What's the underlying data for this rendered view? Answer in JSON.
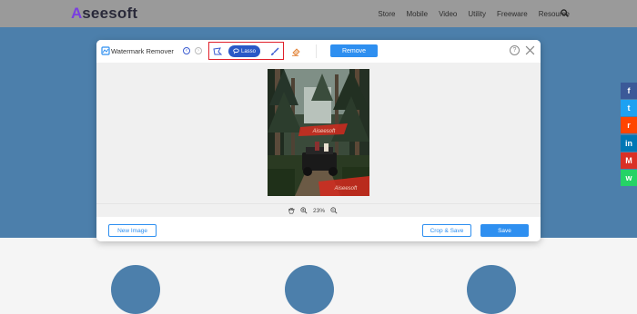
{
  "site": {
    "logo_text": "seesoft",
    "nav": [
      "Store",
      "Mobile",
      "Video",
      "Utility",
      "Freeware",
      "Resource"
    ],
    "search_icon": "search-icon"
  },
  "social": [
    {
      "name": "facebook-icon",
      "glyph": "f",
      "color": "#3b5998"
    },
    {
      "name": "twitter-icon",
      "glyph": "t",
      "color": "#1da1f2"
    },
    {
      "name": "reddit-icon",
      "glyph": "r",
      "color": "#ff4500"
    },
    {
      "name": "linkedin-icon",
      "glyph": "in",
      "color": "#0077b5"
    },
    {
      "name": "gmail-icon",
      "glyph": "M",
      "color": "#d93025"
    },
    {
      "name": "whatsapp-icon",
      "glyph": "w",
      "color": "#25d366"
    }
  ],
  "modal": {
    "title": "Watermark Remover",
    "toolbar": {
      "lasso_label": "Lasso",
      "remove_label": "Remove"
    },
    "help_glyph": "?",
    "photo_watermarks": [
      "Aiseesoft",
      "Aiseesoft"
    ],
    "zoom": {
      "value": "23%"
    },
    "footer": {
      "new_image_label": "New Image",
      "crop_save_label": "Crop & Save",
      "save_label": "Save"
    }
  },
  "colors": {
    "accent": "#2e8ff0",
    "lasso_active": "#2a58c6",
    "highlight_border": "#e0202a",
    "hero_blue": "#4c7fab"
  }
}
